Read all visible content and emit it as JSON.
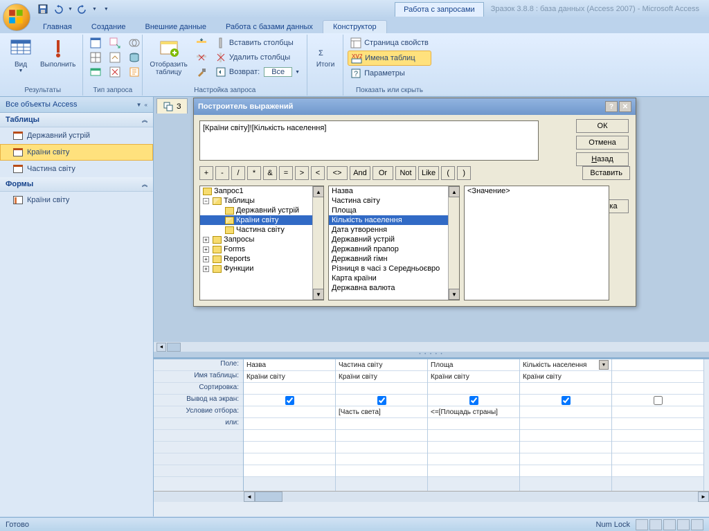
{
  "title": {
    "contextTab": "Работа с запросами",
    "fileName": "Зразок 3.8.8 : база данных (Access 2007) - Microsoft Access"
  },
  "ribbonTabs": {
    "home": "Главная",
    "create": "Создание",
    "external": "Внешние данные",
    "dbtools": "Работа с базами данных",
    "design": "Конструктор"
  },
  "ribbon": {
    "results": {
      "view": "Вид",
      "run": "Выполнить",
      "group": "Результаты"
    },
    "queryType": {
      "group": "Тип запроса"
    },
    "querySetup": {
      "showTable": "Отобразить\nтаблицу",
      "insertCols": "Вставить столбцы",
      "deleteCols": "Удалить столбцы",
      "return": "Возврат:",
      "returnVal": "Все",
      "group": "Настройка запроса"
    },
    "totals": {
      "totals": "Итоги",
      "group": ""
    },
    "showHide": {
      "propSheet": "Страница свойств",
      "tableNames": "Имена таблиц",
      "params": "Параметры",
      "group": "Показать или скрыть"
    }
  },
  "nav": {
    "header": "Все объекты Access",
    "tables": {
      "label": "Таблицы",
      "items": [
        "Державний устрій",
        "Країни світу",
        "Частина світу"
      ]
    },
    "forms": {
      "label": "Формы",
      "items": [
        "Країни світу"
      ]
    }
  },
  "docTab": "З",
  "dialog": {
    "title": "Построитель выражений",
    "expr": "[Країни світу]![Кількість населення]",
    "btns": {
      "ok": "ОК",
      "cancel": "Отмена",
      "back": "Назад",
      "paste": "Вставить",
      "help": "Справка"
    },
    "ops": [
      "+",
      "-",
      "/",
      "*",
      "&",
      "=",
      ">",
      "<",
      "<>",
      "And",
      "Or",
      "Not",
      "Like",
      "(",
      ")"
    ],
    "tree": {
      "root": "Запрос1",
      "tables": "Таблицы",
      "t1": "Державний устрій",
      "t2": "Країни світу",
      "t3": "Частина світу",
      "queries": "Запросы",
      "forms": "Forms",
      "reports": "Reports",
      "functions": "Функции"
    },
    "fields": [
      "Назва",
      "Частина світу",
      "Площа",
      "Кількість населення",
      "Дата утворення",
      "Державний устрій",
      "Державний прапор",
      "Державний гімн",
      "Різниця в часі з Середньоєвро",
      "Карта країни",
      "Державна валюта"
    ],
    "value": "<Значение>"
  },
  "grid": {
    "labels": {
      "field": "Поле:",
      "table": "Имя таблицы:",
      "sort": "Сортировка:",
      "show": "Вывод на экран:",
      "criteria": "Условие отбора:",
      "or": "или:"
    },
    "cols": [
      {
        "field": "Назва",
        "table": "Країни світу",
        "show": true,
        "criteria": ""
      },
      {
        "field": "Частина світу",
        "table": "Країни світу",
        "show": true,
        "criteria": "[Часть света]"
      },
      {
        "field": "Площа",
        "table": "Країни світу",
        "show": true,
        "criteria": "<=[Площадь страны]"
      },
      {
        "field": "Кількість населення",
        "table": "Країни світу",
        "show": true,
        "criteria": ""
      },
      {
        "field": "",
        "table": "",
        "show": false,
        "criteria": ""
      }
    ]
  },
  "status": {
    "ready": "Готово",
    "numlock": "Num Lock"
  }
}
